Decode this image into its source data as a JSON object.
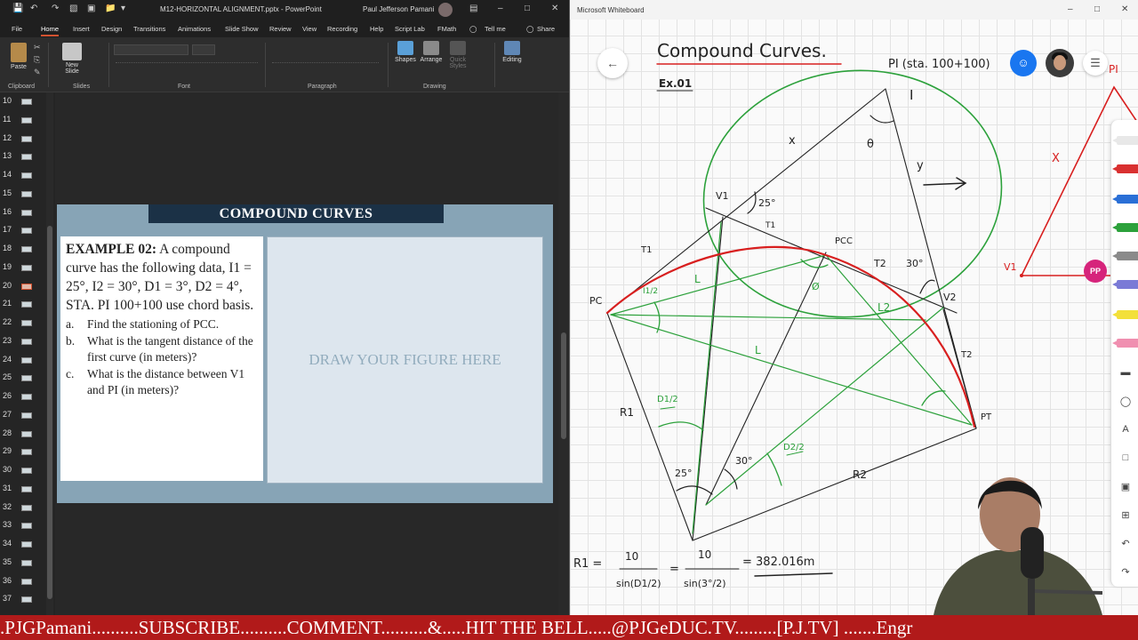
{
  "ppt": {
    "title_bar": {
      "filename": "M12-HORIZONTAL ALIGNMENT.pptx  -  PowerPoint",
      "user": "Paul Jefferson Pamani"
    },
    "tabs": [
      "File",
      "Home",
      "Insert",
      "Design",
      "Transitions",
      "Animations",
      "Slide Show",
      "Review",
      "View",
      "Recording",
      "Help",
      "Script Lab",
      "FMath",
      "Tell me",
      "Share"
    ],
    "ribbon": {
      "groups": [
        "Clipboard",
        "Slides",
        "Font",
        "Paragraph",
        "Drawing"
      ],
      "buttons": {
        "paste": "Paste",
        "new_slide": "New Slide",
        "shapes": "Shapes",
        "arrange": "Arrange",
        "quick_styles": "Quick Styles",
        "editing": "Editing"
      }
    },
    "slide_numbers": [
      "10",
      "11",
      "12",
      "13",
      "14",
      "15",
      "16",
      "17",
      "18",
      "19",
      "20",
      "21",
      "22",
      "23",
      "24",
      "25",
      "26",
      "27",
      "28",
      "29",
      "30",
      "31",
      "32",
      "33",
      "34",
      "35",
      "36",
      "37"
    ],
    "selected_slide": "20",
    "slide": {
      "title": "COMPOUND CURVES",
      "example_label": "EXAMPLE 02:",
      "example_text": "A compound curve has the following data, I1 = 25°, I2 = 30°, D1 = 3°, D2 = 4°, STA. PI 100+100 use chord basis.",
      "questions": [
        {
          "letter": "a.",
          "text": "Find the stationing of PCC."
        },
        {
          "letter": "b.",
          "text": "What is the tangent distance of the first curve (in meters)?"
        },
        {
          "letter": "c.",
          "text": "What is the distance between V1 and PI (in meters)?"
        }
      ],
      "placeholder": "DRAW YOUR FIGURE HERE"
    }
  },
  "whiteboard": {
    "title_bar": "Microsoft Whiteboard",
    "pp_badge": "PP",
    "handwriting": {
      "heading": "Compound Curves.",
      "example": "Ex.01",
      "pi": "PI (sta. 100+100)",
      "i_mark": "I",
      "theta": "θ",
      "x": "x",
      "y": "y",
      "v1": "V1",
      "deg25": "25°",
      "t1_upper": "T1",
      "t1_left": "T1",
      "pcc": "PCC",
      "t2_upper": "T2",
      "deg30_upper": "30°",
      "v2": "V2",
      "pc": "PC",
      "l_left": "L",
      "l_upper": "L",
      "l2": "L2",
      "l_mid": "L",
      "phi": "Ø",
      "t2_lower": "T2",
      "r1": "R1",
      "pt": "PT",
      "deg25_lower": "25°",
      "deg30_lower": "30°",
      "r2": "R2",
      "half_i1": "I1/2",
      "d1_half": "D1/2",
      "d2_half": "D2/2",
      "right_pi": "PI",
      "right_x": "X",
      "right_v1": "V1",
      "r1_formula": "R1 =",
      "num10": "10",
      "sin_d1": "sin(D1/2)",
      "eq": "=",
      "sin_3": "sin(3°/2)",
      "r1_result": "= 382.016m"
    }
  },
  "ticker": ".PJGPamani..........SUBSCRIBE..........COMMENT..........&.....HIT THE BELL.....@PJGeDUC.TV.........[P.J.TV] .......Engr"
}
